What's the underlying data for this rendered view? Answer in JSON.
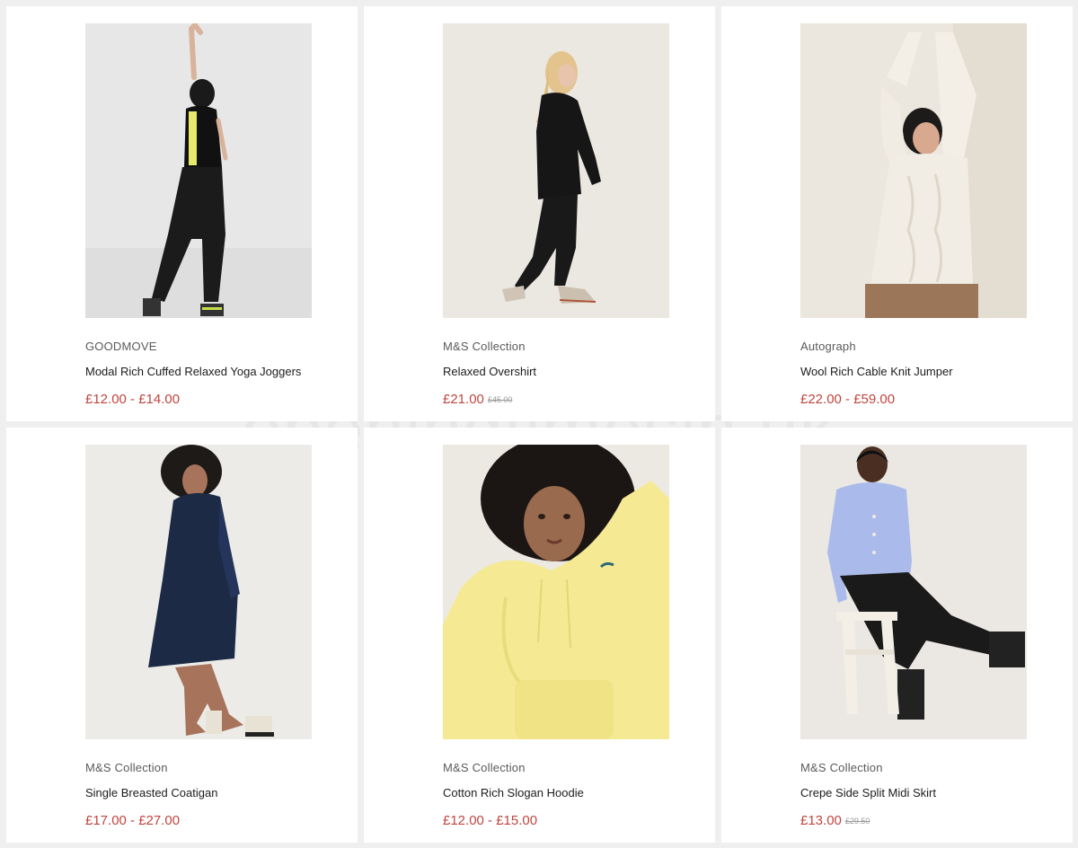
{
  "watermark": "openingtimesin.uk",
  "colors": {
    "page_background": "#efefef",
    "card_background": "#ffffff",
    "price": "#c0463f",
    "old_price": "#9a9a9a"
  },
  "products": [
    {
      "brand": "GOODMOVE",
      "title": "Modal Rich Cuffed Relaxed Yoga Joggers",
      "price": "£12.00 - £14.00",
      "old_price": "",
      "image": "woman-in-black-yoga-joggers-photo"
    },
    {
      "brand": "M&S Collection",
      "title": "Relaxed Overshirt",
      "price": "£21.00",
      "old_price": "£45.00",
      "image": "woman-in-black-overshirt-photo"
    },
    {
      "brand": "Autograph",
      "title": "Wool Rich Cable Knit Jumper",
      "price": "£22.00 - £59.00",
      "old_price": "",
      "image": "woman-in-cream-cable-knit-jumper-photo"
    },
    {
      "brand": "M&S Collection",
      "title": "Single Breasted Coatigan",
      "price": "£17.00 - £27.00",
      "old_price": "",
      "image": "woman-in-navy-coatigan-photo"
    },
    {
      "brand": "M&S Collection",
      "title": "Cotton Rich Slogan Hoodie",
      "price": "£12.00 - £15.00",
      "old_price": "",
      "image": "woman-in-yellow-hoodie-photo"
    },
    {
      "brand": "M&S Collection",
      "title": "Crepe Side Split Midi Skirt",
      "price": "£13.00",
      "old_price": "£29.50",
      "image": "woman-in-black-midi-skirt-photo"
    }
  ]
}
